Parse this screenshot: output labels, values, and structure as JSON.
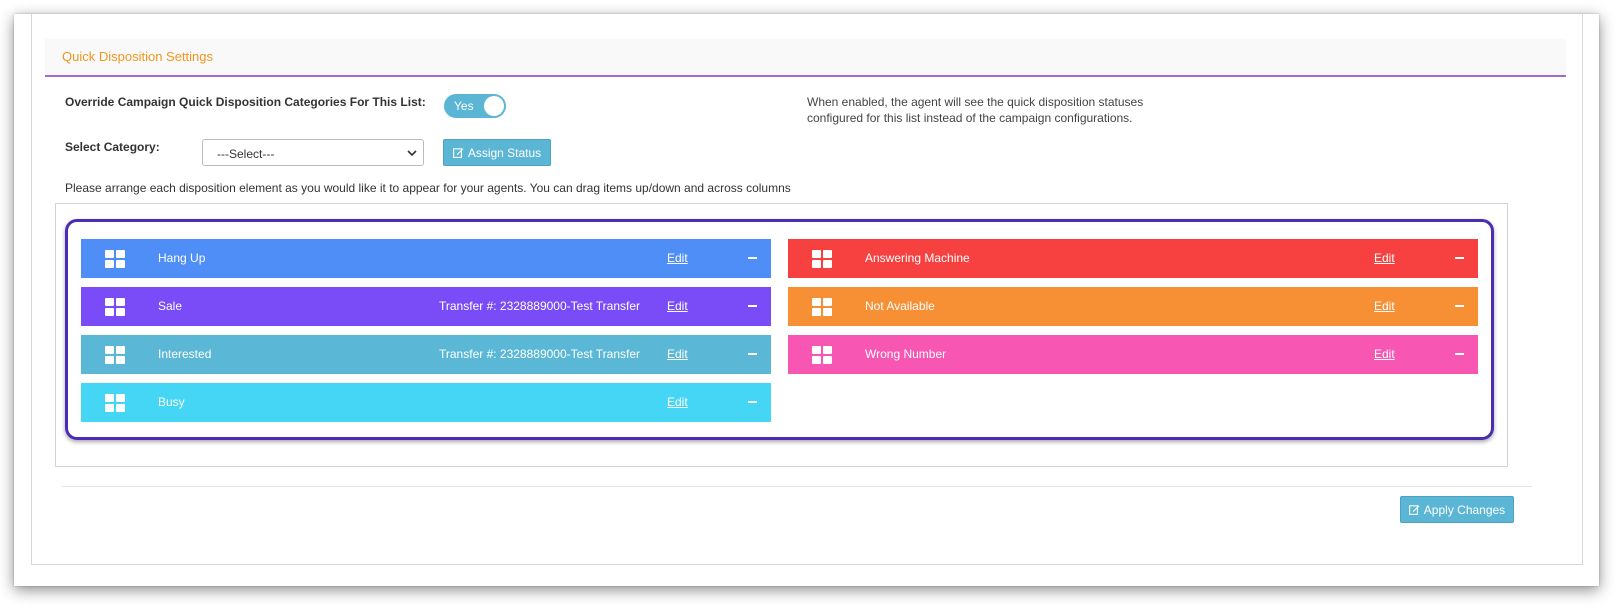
{
  "panel": {
    "title": "Quick Disposition Settings"
  },
  "override": {
    "label": "Override Campaign Quick Disposition Categories For This List:",
    "toggle_text": "Yes",
    "help_text": "When enabled, the agent will see the quick disposition statuses configured for this list instead of the campaign configurations."
  },
  "category": {
    "label": "Select Category:",
    "selected": "---Select---",
    "assign_button": "Assign Status"
  },
  "instruction": "Please arrange each disposition element as you would like it to appear for your agents. You can drag items up/down and across columns",
  "left_column": [
    {
      "name": "Hang Up",
      "transfer": "",
      "edit": "Edit",
      "color": "#4f8ef7"
    },
    {
      "name": "Sale",
      "transfer": "Transfer #: 2328889000-Test Transfer",
      "edit": "Edit",
      "color": "#7a4cf7"
    },
    {
      "name": "Interested",
      "transfer": "Transfer #: 2328889000-Test Transfer",
      "edit": "Edit",
      "color": "#5ab8d6"
    },
    {
      "name": "Busy",
      "transfer": "",
      "edit": "Edit",
      "color": "#45d6f5"
    }
  ],
  "right_column": [
    {
      "name": "Answering Machine",
      "edit": "Edit",
      "color": "#f74040"
    },
    {
      "name": "Not Available",
      "edit": "Edit",
      "color": "#f78f35"
    },
    {
      "name": "Wrong Number",
      "edit": "Edit",
      "color": "#f757b2"
    }
  ],
  "footer": {
    "apply_button": "Apply Changes"
  },
  "colors": {
    "accent": "#5bb6d6",
    "title": "#f0961e",
    "header_underline": "#a06cc8",
    "highlight_border": "#4c2cb6"
  },
  "icons": {
    "drag_handle": "grid-icon",
    "remove": "minus-icon",
    "edit_button": "edit-icon",
    "select": "chevron-down-icon"
  }
}
